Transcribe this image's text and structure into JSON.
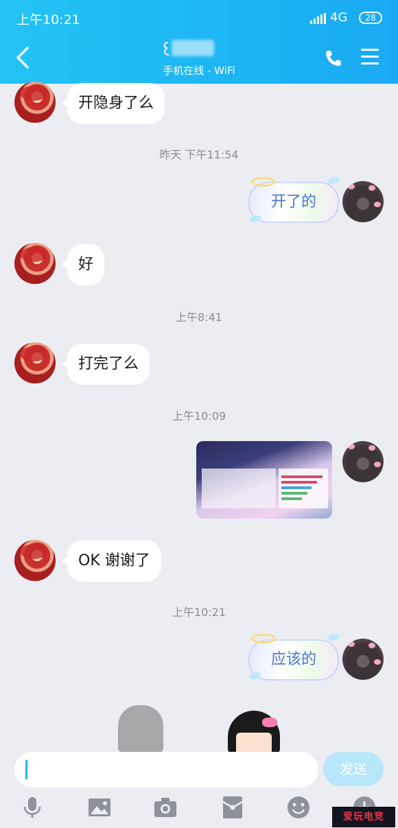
{
  "status_bar": {
    "time": "上午10:21",
    "network": "4G",
    "battery": "28"
  },
  "header": {
    "subtitle": "手机在线 - WiFi"
  },
  "messages": [
    {
      "side": "left",
      "text": "开隐身了么"
    },
    {
      "timestamp": "昨天 下午11:54"
    },
    {
      "side": "right",
      "text": "开了的"
    },
    {
      "side": "left",
      "text": "好"
    },
    {
      "timestamp": "上午8:41"
    },
    {
      "side": "left",
      "text": "打完了么"
    },
    {
      "timestamp": "上午10:09"
    },
    {
      "side": "right",
      "type": "image"
    },
    {
      "side": "left",
      "text": "OK 谢谢了"
    },
    {
      "timestamp": "上午10:21"
    },
    {
      "side": "right",
      "text": "应该的"
    }
  ],
  "input": {
    "value": "",
    "send_label": "发送"
  },
  "toolbar": {
    "icons": [
      "microphone-icon",
      "image-icon",
      "camera-icon",
      "red-packet-icon",
      "emoji-icon",
      "plus-icon"
    ]
  },
  "watermark": {
    "text": "爱玩电竞"
  },
  "colors": {
    "header_start": "#23c3f5",
    "header_end": "#19aaf3",
    "background": "#ecedf3",
    "send_button": "#b8e6fb",
    "right_text": "#4b73d6"
  }
}
